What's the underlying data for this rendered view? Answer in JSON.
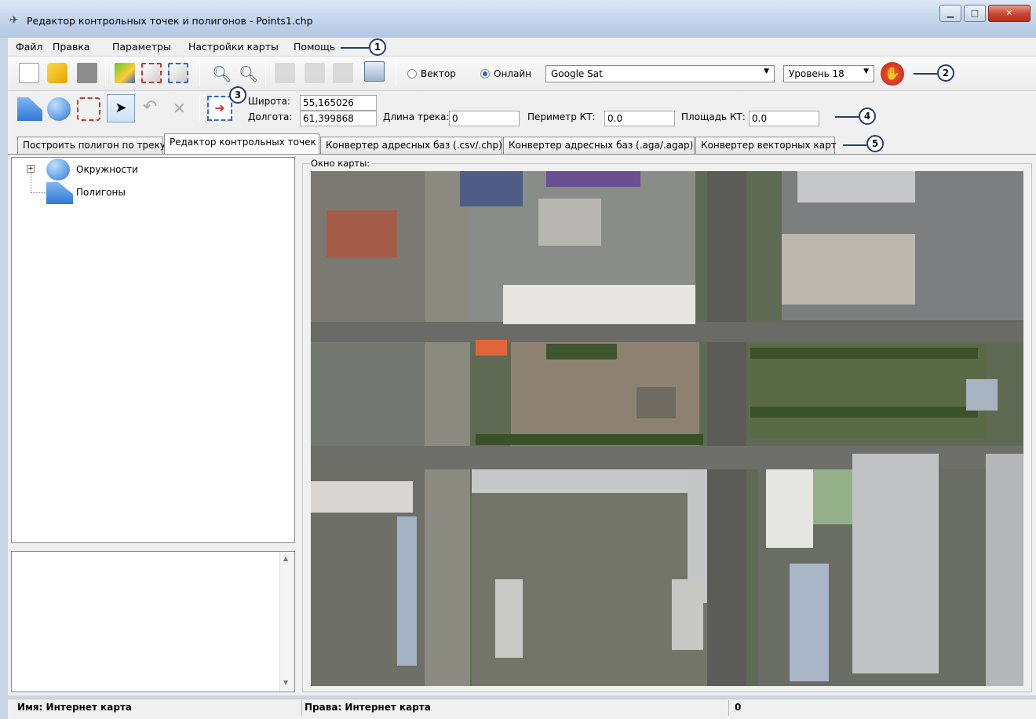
{
  "window": {
    "title": "Редактор контрольных точек и полигонов - Points1.chp"
  },
  "menu": {
    "items": [
      "Файл",
      "Правка",
      "Параметры",
      "Настройки карты",
      "Помощь"
    ]
  },
  "toolbar": {
    "vector_label": "Вектор",
    "online_label": "Онлайн",
    "online_selected": true,
    "map_source": "Google Sat",
    "level": "Уровень 18"
  },
  "coords": {
    "lat_label": "Широта:",
    "lat_value": "55,165026",
    "lon_label": "Долгота:",
    "lon_value": "61,399868",
    "track_label": "Длина трека:",
    "track_value": "0",
    "perimeter_label": "Периметр КТ:",
    "perimeter_value": "0.0",
    "area_label": "Площадь КТ:",
    "area_value": "0.0"
  },
  "tabs": [
    {
      "label": "Построить полигон по треку",
      "active": false
    },
    {
      "label": "Редактор контрольных точек",
      "active": true
    },
    {
      "label": "Конвертер адресных баз (.csv/.chp)",
      "active": false
    },
    {
      "label": "Конвертер адресных баз (.aga/.agap)",
      "active": false
    },
    {
      "label": "Конвертер векторных карт",
      "active": false
    }
  ],
  "tree": {
    "items": [
      "Окружности",
      "Полигоны"
    ]
  },
  "map": {
    "frame_label": "Окно карты:"
  },
  "status": {
    "name": "Имя: Интернет карта",
    "rights": "Права: Интернет карта",
    "value": "0"
  },
  "callouts": [
    "1",
    "2",
    "3",
    "4",
    "5"
  ],
  "colors": {
    "titlebar": "#c0d2ea",
    "accent": "#243f6e",
    "stop": "#d9341c"
  }
}
